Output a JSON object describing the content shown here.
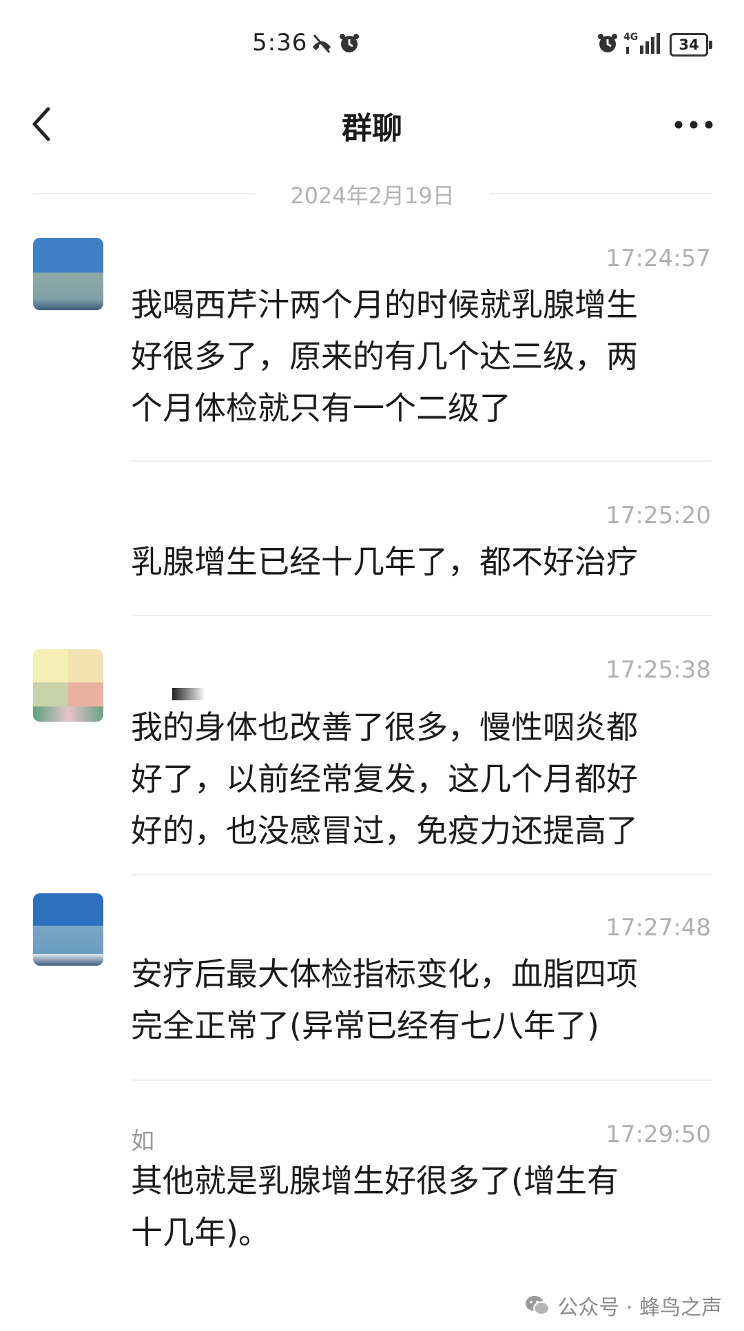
{
  "status_bar": {
    "time": "5:36",
    "battery": "34",
    "network": "4G"
  },
  "header": {
    "title": "群聊"
  },
  "date_divider": "2024年2月19日",
  "messages": [
    {
      "time": "17:24:57",
      "text": "我喝西芹汁两个月的时候就乳腺增生\n好很多了，原来的有几个达三级，两\n个月体检就只有一个二级了"
    },
    {
      "time": "17:25:20",
      "text": "乳腺增生已经十几年了，都不好治疗"
    },
    {
      "time": "17:25:38",
      "text": "我的身体也改善了很多，慢性咽炎都\n好了，以前经常复发，这几个月都好\n好的，也没感冒过，免疫力还提高了"
    },
    {
      "time": "17:27:48",
      "text": "安疗后最大体检指标变化，血脂四项\n完全正常了(异常已经有七八年了)"
    },
    {
      "time": "17:29:50",
      "sender_fragment": "如",
      "text": "其他就是乳腺增生好很多了(增生有\n十几年)。"
    }
  ],
  "watermark": "公众号 · 蜂鸟之声",
  "colors": {
    "text": "#1b1b1b",
    "timestamp": "#b0b0b0",
    "divider": "#eeeeee"
  }
}
